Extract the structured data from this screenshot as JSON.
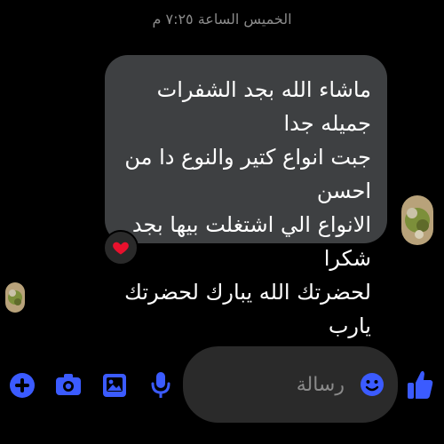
{
  "timestamp": "الخميس الساعة ٧:٢٥ م",
  "message": {
    "text": "ماشاء الله بجد الشفرات جميله جدا\nجبت انواع كتير والنوع دا من احسن\nالانواع الي اشتغلت بيها بجد شكرا\nلحضرتك الله يبارك لحضرتك يارب",
    "reaction": "heart"
  },
  "composer": {
    "placeholder": "رسالة",
    "value": ""
  },
  "colors": {
    "accent": "#3b5bff",
    "bubble": "#3e4042",
    "heart": "#e8112d"
  },
  "toolbar": {
    "icons": [
      "plus-icon",
      "camera-icon",
      "gallery-icon",
      "microphone-icon",
      "emoji-icon",
      "like-icon"
    ]
  }
}
